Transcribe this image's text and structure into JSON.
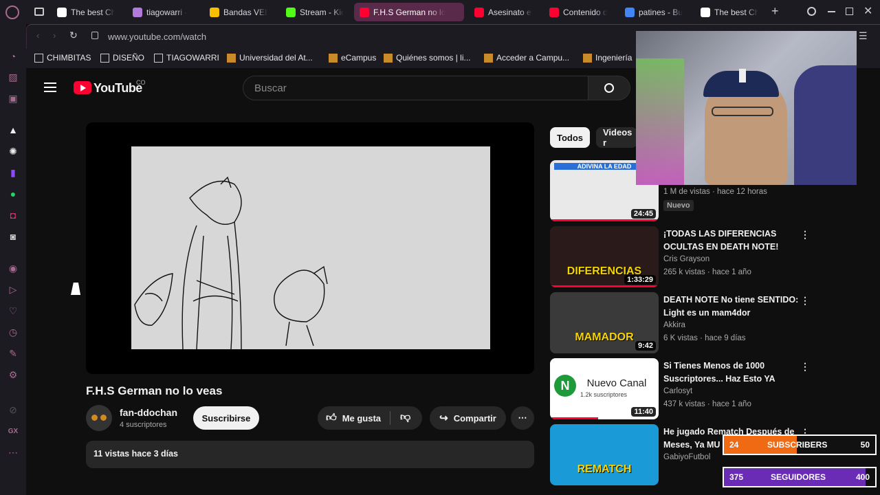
{
  "browser": {
    "tabs": [
      {
        "label": "The best Ch",
        "color": "#ffffff",
        "active": false
      },
      {
        "label": "tiagowarri -",
        "color": "#b27bd9",
        "active": false
      },
      {
        "label": "Bandas VEE",
        "color": "#f6c000",
        "active": false
      },
      {
        "label": "Stream - Kic",
        "color": "#53fc18",
        "active": false
      },
      {
        "label": "F.H.S German no lo",
        "color": "#ff0033",
        "active": true
      },
      {
        "label": "Asesinato er",
        "color": "#ff0033",
        "active": false
      },
      {
        "label": "Contenido d",
        "color": "#ff0033",
        "active": false
      },
      {
        "label": "patines - Bu",
        "color": "#4285f4",
        "active": false
      },
      {
        "label": "The best Ch",
        "color": "#ffffff",
        "active": false
      }
    ],
    "url": "www.youtube.com/watch",
    "bookmarks": [
      "CHIMBITAS",
      "DISEÑO",
      "TIAGOWARRI",
      "Universidad del At...",
      "eCampus",
      "Quiénes somos | li...",
      "Acceder a Campu...",
      "Ingeniería"
    ]
  },
  "youtube": {
    "logo": "YouTube",
    "region": "CO",
    "search_placeholder": "Buscar",
    "video_title": "F.H.S German no lo veas",
    "channel_name": "fan-ddochan",
    "subscribers": "4 suscriptores",
    "subscribe_label": "Suscribirse",
    "like_label": "Me gusta",
    "share_label": "Compartir",
    "description": "11 vistas  hace 3 días",
    "chips": [
      "Todos",
      "Videos r"
    ],
    "recommendations": [
      {
        "title": "",
        "channel": "",
        "meta": "1 M de vistas · hace 12 horas",
        "badge": "Nuevo",
        "duration": "24:45",
        "thumb_text": "ADIVINA LA EDAD",
        "thumb_color": "#e9e9e9"
      },
      {
        "title": "¡TODAS LAS DIFERENCIAS OCULTAS EN DEATH NOTE!",
        "channel": "Cris Grayson",
        "meta": "265 k vistas · hace 1 año",
        "duration": "1:33:29",
        "thumb_text": "DIFERENCIAS",
        "thumb_color": "#2b1a1a"
      },
      {
        "title": "DEATH NOTE No tiene SENTIDO: Light es un mam4dor",
        "channel": "Akkira",
        "meta": "6 K vistas · hace 9 días",
        "duration": "9:42",
        "thumb_text": "MAMADOR",
        "thumb_color": "#3a3a3a"
      },
      {
        "title": "Si Tienes Menos de 1000 Suscriptores... Haz Esto YA",
        "channel": "Carlosyt",
        "meta": "437 k vistas · hace 1 año",
        "duration": "11:40",
        "thumb_text": "Nuevo Canal",
        "thumb_sub": "1.2k suscriptores",
        "thumb_color": "#ffffff"
      },
      {
        "title": "He jugado Rematch Después de Meses, Ya MU",
        "channel": "GabiyoFutbol",
        "meta": "",
        "duration": "",
        "thumb_text": "REMATCH",
        "thumb_color": "#1a9ad6"
      }
    ]
  },
  "overlay": {
    "subscribers_goal": {
      "current": "24",
      "label": "SUBSCRIBERS",
      "target": "50",
      "progress": 0.48
    },
    "followers_goal": {
      "current": "375",
      "label": "SEGUIDORES",
      "target": "400",
      "progress": 0.9375
    }
  },
  "colors": {
    "accent": "#ff0033",
    "subs_bar": "#f06a14",
    "followers_bar": "#6a2bb5"
  }
}
